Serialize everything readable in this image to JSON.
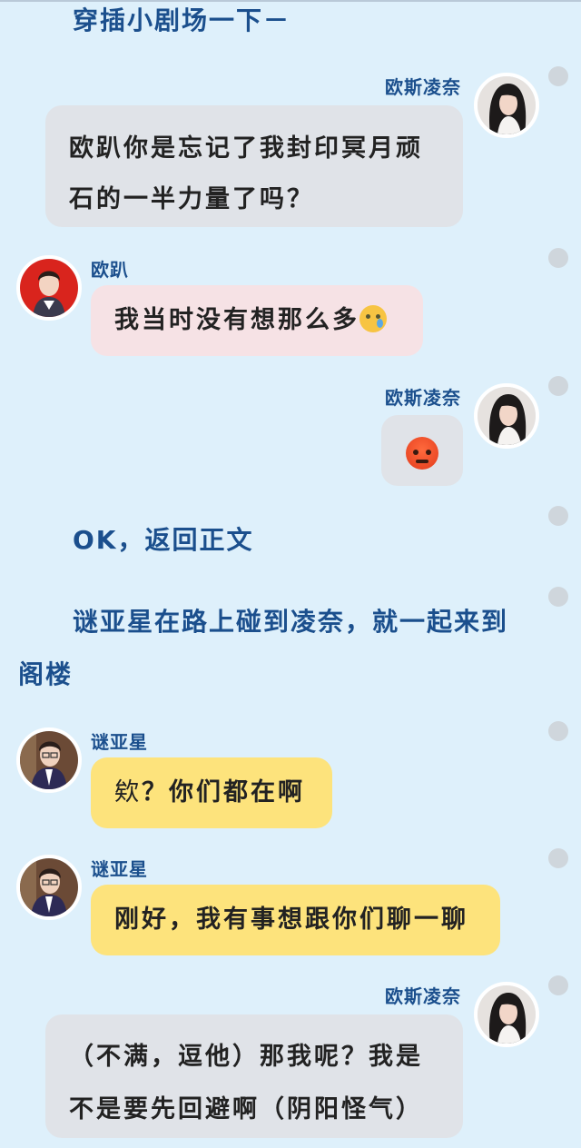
{
  "narration": {
    "interlude": "穿插小剧场一下－",
    "back_to_text": "OK，返回正文",
    "paragraph_line1": "谜亚星在路上碰到凌奈，就一起来到",
    "paragraph_line2": "阁楼"
  },
  "messages": [
    {
      "speaker": "欧斯凌奈",
      "side": "right",
      "lines": [
        "欧趴你是忘记了我封印冥月顽",
        "石的一半力量了吗？"
      ]
    },
    {
      "speaker": "欧趴",
      "side": "left",
      "text": "我当时没有想那么多",
      "emoji": "crying-face-icon"
    },
    {
      "speaker": "欧斯凌奈",
      "side": "right",
      "emoji": "angry-face-icon"
    },
    {
      "speaker": "谜亚星",
      "side": "left",
      "text_prefix": "欸",
      "text": "？你们都在啊"
    },
    {
      "speaker": "谜亚星",
      "side": "left",
      "text": "刚好，我有事想跟你们聊一聊"
    },
    {
      "speaker": "欧斯凌奈",
      "side": "right",
      "lines": [
        "（不满，逗他）那我呢？我是",
        "不是要先回避啊（阴阳怪气）"
      ]
    }
  ],
  "colors": {
    "background": "#def0fb",
    "name_text": "#1b4f8d",
    "bubble_gray": "#e0e3e8",
    "bubble_pink": "#f6e2e5",
    "bubble_yellow": "#fde37c",
    "side_dot": "#cfd6dc"
  }
}
